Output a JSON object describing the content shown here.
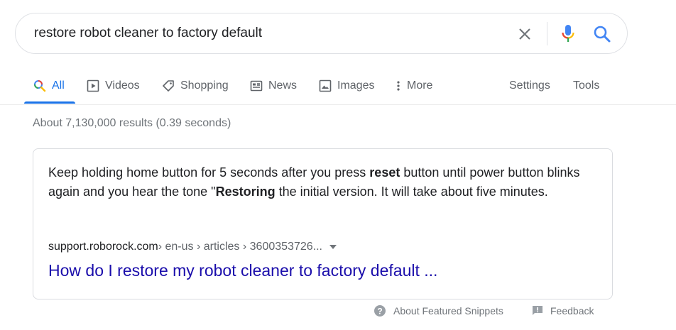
{
  "search": {
    "query": "restore robot cleaner to factory default"
  },
  "tabs": [
    {
      "label": "All",
      "icon": "search-icon",
      "active": true
    },
    {
      "label": "Videos",
      "icon": "video-icon"
    },
    {
      "label": "Shopping",
      "icon": "tag-icon"
    },
    {
      "label": "News",
      "icon": "newspaper-icon"
    },
    {
      "label": "Images",
      "icon": "image-icon"
    },
    {
      "label": "More",
      "icon": "more-vert-icon"
    },
    {
      "label": "Settings"
    },
    {
      "label": "Tools"
    }
  ],
  "results": {
    "stats": "About 7,130,000 results (0.39 seconds)"
  },
  "featured_snippet": {
    "text_parts": [
      "Keep holding home button for 5 seconds after you press ",
      "reset",
      " button until power button blinks again and you hear the tone \"",
      "Restoring",
      " the initial version. It will take about five minutes."
    ],
    "cite_domain": "support.roborock.com",
    "cite_path": " › en-us › articles › 3600353726...",
    "link_title": "How do I restore my robot cleaner to factory default ..."
  },
  "footer": {
    "about_label": "About Featured Snippets",
    "feedback_label": "Feedback"
  },
  "colors": {
    "accent": "#1a73e8",
    "link": "#1a0dab",
    "muted": "#70757a"
  }
}
